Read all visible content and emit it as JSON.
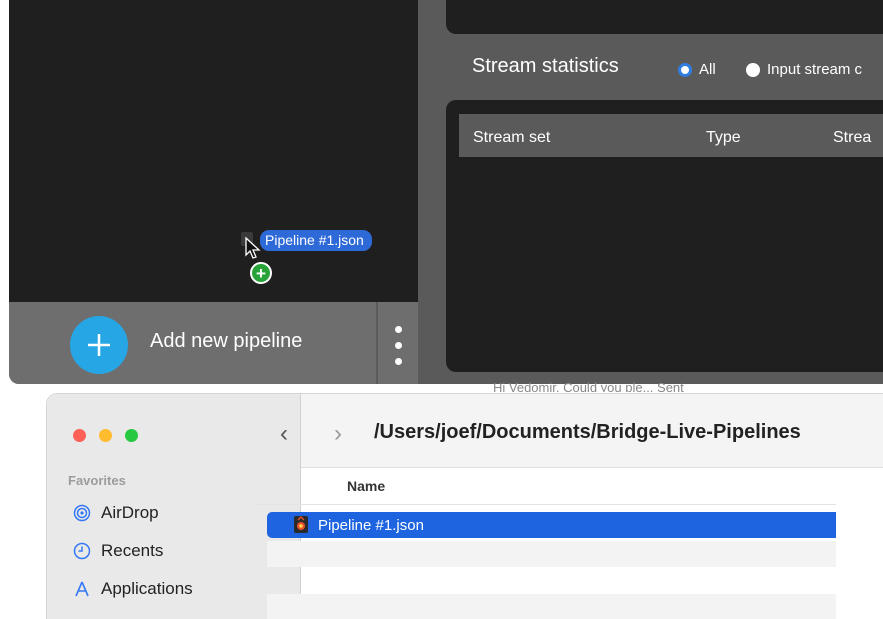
{
  "app": {
    "add_pipeline_label": "Add new pipeline",
    "stats_title": "Stream statistics",
    "radio_all": "All",
    "radio_input": "Input stream c",
    "columns": [
      "Stream set",
      "Type",
      "Strea"
    ],
    "drag_label": "Pipeline #1.json",
    "background_hint": "Hi Vedomir, Could you ple...   Sent"
  },
  "finder": {
    "sidebar_heading": "Favorites",
    "sidebar_items": [
      {
        "label": "AirDrop",
        "icon": "airdrop-icon"
      },
      {
        "label": "Recents",
        "icon": "clock-icon"
      },
      {
        "label": "Applications",
        "icon": "applications-icon"
      }
    ],
    "path": "/Users/joef/Documents/Bridge-Live-Pipelines",
    "name_header": "Name",
    "files": [
      {
        "name": "Pipeline #1.json",
        "selected": true
      }
    ]
  },
  "colors": {
    "accent": "#27a6e6",
    "selection": "#1e64e0",
    "copy_badge": "#27a33a"
  }
}
